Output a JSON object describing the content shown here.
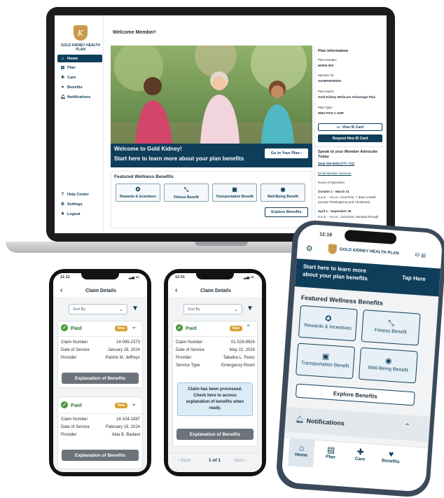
{
  "laptop": {
    "brand": "GOLD KIDNEY HEALTH PLAN",
    "nav": [
      {
        "label": "Home",
        "icon": "home-icon"
      },
      {
        "label": "Plan",
        "icon": "plan-icon"
      },
      {
        "label": "Care",
        "icon": "care-icon"
      },
      {
        "label": "Benefits",
        "icon": "heart-icon"
      },
      {
        "label": "Notifications",
        "icon": "bell-icon"
      }
    ],
    "bottom_nav": [
      {
        "label": "Help Center",
        "icon": "help-icon"
      },
      {
        "label": "Settings",
        "icon": "gear-icon"
      },
      {
        "label": "Logout",
        "icon": "lock-icon"
      }
    ],
    "welcome": "Welcome Member!",
    "banner_title": "Welcome to Gold Kidney!",
    "banner_subtitle": "Start here to learn more about your plan benefits",
    "go_to_plan": "Go to Your Plan",
    "featured_title": "Featured Wellness Benefits",
    "benefits": [
      {
        "label": "Rewards & Incentives",
        "icon": "star-badge-icon"
      },
      {
        "label": "Fitness Benefit",
        "icon": "dumbbell-icon"
      },
      {
        "label": "Transportation Benefit",
        "icon": "bus-icon"
      },
      {
        "label": "Well-Being Benefit",
        "icon": "head-icon"
      }
    ],
    "explore": "Explore Benefits",
    "plan_info": {
      "title": "Plan Information",
      "plan_number_label": "Plan Number:",
      "plan_number": "H0000-000",
      "member_id_label": "Member ID:",
      "member_id": "GKHP00000000",
      "plan_name_label": "Plan Name:",
      "plan_name": "Gold Kidney Medicare Advantage Plan",
      "plan_type_label": "Plan Type:",
      "plan_type": "HMO-POS C-SNP",
      "view_id": "View ID Card",
      "request_id": "Request New ID Card"
    },
    "advocate": {
      "title_1": "Speak to your Member Advocate",
      "title_2": "Today",
      "phone": "(844) 294-6535 (TTY 711)",
      "email": "Email Member Services",
      "hours": "Hours of Operation",
      "period_1": "October 1 - March 31",
      "period_1_line_1": "8 a.m. – 8 p.m., local time, 7 days a week",
      "period_1_line_2": "(except Thanksgiving and Christmas)",
      "period_2": "April 1 - September 30",
      "period_2_line_1": "8 a.m. – 8 p.m., local time, Monday through"
    }
  },
  "phone1": {
    "time": "11:12",
    "header": "Claim Details",
    "sort": "Sort By",
    "claims": [
      {
        "status": "Paid",
        "badge": "New",
        "claim_label": "Claim Number",
        "claim": "14-095-2373",
        "date_label": "Date of Service",
        "date": "January 28, 2024",
        "provider_label": "Provider",
        "provider": "Patrick M. Jeffreys",
        "eob": "Explanation of Benefits"
      },
      {
        "status": "Paid",
        "badge": "New",
        "claim_label": "Claim Number",
        "claim": "14-104-1987",
        "date_label": "Date of Service",
        "date": "February 19, 2024",
        "provider_label": "Provider",
        "provider": "Akia B. Badawi",
        "eob": "Explanation of Benefits"
      }
    ]
  },
  "phone2": {
    "time": "12:01",
    "header": "Claim Details",
    "sort": "Sort By",
    "claim": {
      "status": "Paid",
      "badge": "New",
      "claim_label": "Claim Number",
      "claim": "01-528-9924",
      "date_label": "Date of Service",
      "date": "May 22, 2024",
      "provider_label": "Provider",
      "provider": "Tabatha L. Perez",
      "type_label": "Service Type",
      "type": "Emergency Room"
    },
    "notice": "Claim has been processed. Check here to access explanation of benefits when ready.",
    "eob": "Explanation of Benefits",
    "back": "Back",
    "page": "1 of 1",
    "next": "Next"
  },
  "phone3": {
    "time": "12:19",
    "brand": "GOLD KIDNEY HEALTH PLAN",
    "id_label": "ID",
    "banner": "Start here to learn more about your plan benefits",
    "tap": "Tap Here",
    "featured_title": "Featured Wellness Benefits",
    "benefits": [
      {
        "label": "Rewards & Incentives",
        "icon": "star-badge-icon"
      },
      {
        "label": "Fitness Benefit",
        "icon": "dumbbell-icon"
      },
      {
        "label": "Transportation Benefit",
        "icon": "bus-icon"
      },
      {
        "label": "Well-Being Benefit",
        "icon": "head-icon"
      }
    ],
    "explore": "Explore Benefits",
    "notifications": "Notifications",
    "tabs": [
      {
        "label": "Home",
        "icon": "home-icon"
      },
      {
        "label": "Plan",
        "icon": "plan-icon"
      },
      {
        "label": "Care",
        "icon": "care-icon"
      },
      {
        "label": "Benefits",
        "icon": "heart-icon"
      }
    ]
  },
  "colors": {
    "navy": "#0e3e5a",
    "gold": "#c89a4a",
    "paid_green": "#2f7a32",
    "badge": "#d6a12c"
  }
}
